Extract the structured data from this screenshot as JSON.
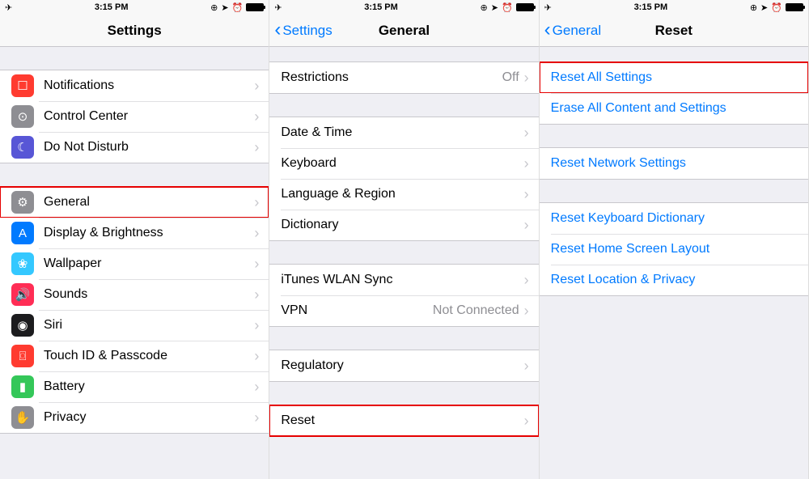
{
  "status": {
    "time": "3:15 PM",
    "airplane_glyph": "✈",
    "orientation_glyph": "⊕",
    "location_glyph": "➤",
    "alarm_glyph": "⏰"
  },
  "pane1": {
    "title": "Settings",
    "groupA": [
      {
        "label": "Notifications",
        "icon": "notifications-icon",
        "bg": "bg-red",
        "glyph": "☐"
      },
      {
        "label": "Control Center",
        "icon": "control-center-icon",
        "bg": "bg-gray",
        "glyph": "⊙"
      },
      {
        "label": "Do Not Disturb",
        "icon": "dnd-icon",
        "bg": "bg-purple",
        "glyph": "☾"
      }
    ],
    "groupB": [
      {
        "label": "General",
        "icon": "general-icon",
        "bg": "bg-gray",
        "glyph": "⚙",
        "hl": true
      },
      {
        "label": "Display & Brightness",
        "icon": "display-icon",
        "bg": "bg-blue",
        "glyph": "A"
      },
      {
        "label": "Wallpaper",
        "icon": "wallpaper-icon",
        "bg": "bg-cyan",
        "glyph": "❀"
      },
      {
        "label": "Sounds",
        "icon": "sounds-icon",
        "bg": "bg-pink",
        "glyph": "🔊"
      },
      {
        "label": "Siri",
        "icon": "siri-icon",
        "bg": "bg-black",
        "glyph": "◉"
      },
      {
        "label": "Touch ID & Passcode",
        "icon": "touchid-icon",
        "bg": "bg-red",
        "glyph": "⌼"
      },
      {
        "label": "Battery",
        "icon": "battery-icon",
        "bg": "bg-green",
        "glyph": "▮"
      },
      {
        "label": "Privacy",
        "icon": "privacy-icon",
        "bg": "bg-gray",
        "glyph": "✋"
      }
    ]
  },
  "pane2": {
    "back": "Settings",
    "title": "General",
    "groupA": [
      {
        "label": "Restrictions",
        "detail": "Off"
      }
    ],
    "groupB": [
      {
        "label": "Date & Time"
      },
      {
        "label": "Keyboard"
      },
      {
        "label": "Language & Region"
      },
      {
        "label": "Dictionary"
      }
    ],
    "groupC": [
      {
        "label": "iTunes WLAN Sync"
      },
      {
        "label": "VPN",
        "detail": "Not Connected"
      }
    ],
    "groupD": [
      {
        "label": "Regulatory"
      }
    ],
    "groupE": [
      {
        "label": "Reset",
        "hl": true
      }
    ]
  },
  "pane3": {
    "back": "General",
    "title": "Reset",
    "groupA": [
      {
        "label": "Reset All Settings",
        "hl": true
      },
      {
        "label": "Erase All Content and Settings"
      }
    ],
    "groupB": [
      {
        "label": "Reset Network Settings"
      }
    ],
    "groupC": [
      {
        "label": "Reset Keyboard Dictionary"
      },
      {
        "label": "Reset Home Screen Layout"
      },
      {
        "label": "Reset Location & Privacy"
      }
    ]
  }
}
